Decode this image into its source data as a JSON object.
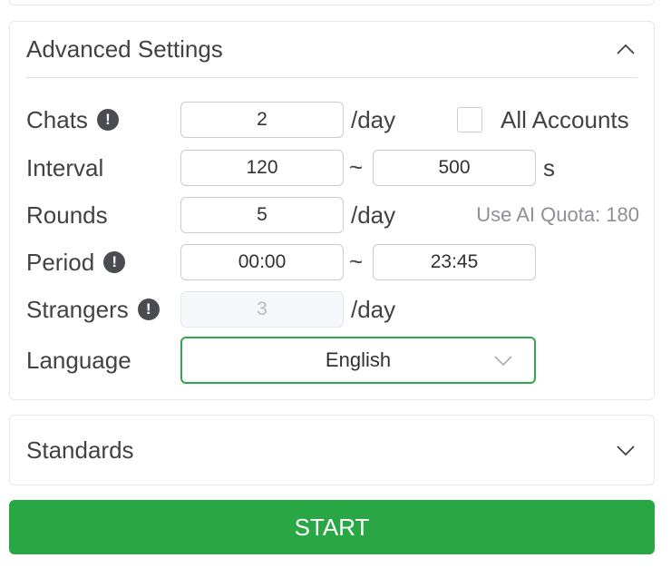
{
  "advanced": {
    "title": "Advanced Settings",
    "expanded": true,
    "rows": {
      "chats": {
        "label": "Chats",
        "value": "2",
        "unit": "/day",
        "has_info": true
      },
      "all_accounts": {
        "label": "All Accounts",
        "checked": false
      },
      "interval": {
        "label": "Interval",
        "min": "120",
        "max": "500",
        "unit": "s",
        "separator": "~"
      },
      "rounds": {
        "label": "Rounds",
        "value": "5",
        "unit": "/day",
        "quota_text": "Use AI Quota: 180"
      },
      "period": {
        "label": "Period",
        "start": "00:00",
        "end": "23:45",
        "separator": "~",
        "has_info": true
      },
      "strangers": {
        "label": "Strangers",
        "value": "3",
        "unit": "/day",
        "disabled": true,
        "has_info": true
      },
      "language": {
        "label": "Language",
        "value": "English"
      }
    }
  },
  "standards": {
    "title": "Standards",
    "expanded": false
  },
  "start_button": {
    "label": "START"
  },
  "colors": {
    "accent": "#29a745",
    "select_border": "#2ea84a",
    "info_icon": "#4a4c52",
    "border": "#e4e7ed",
    "quota_text": "#8e9096"
  },
  "icons": {
    "info": "exclamation-circle-icon",
    "collapse": "chevron-up-icon",
    "expand": "chevron-down-icon",
    "select": "chevron-down-icon"
  }
}
